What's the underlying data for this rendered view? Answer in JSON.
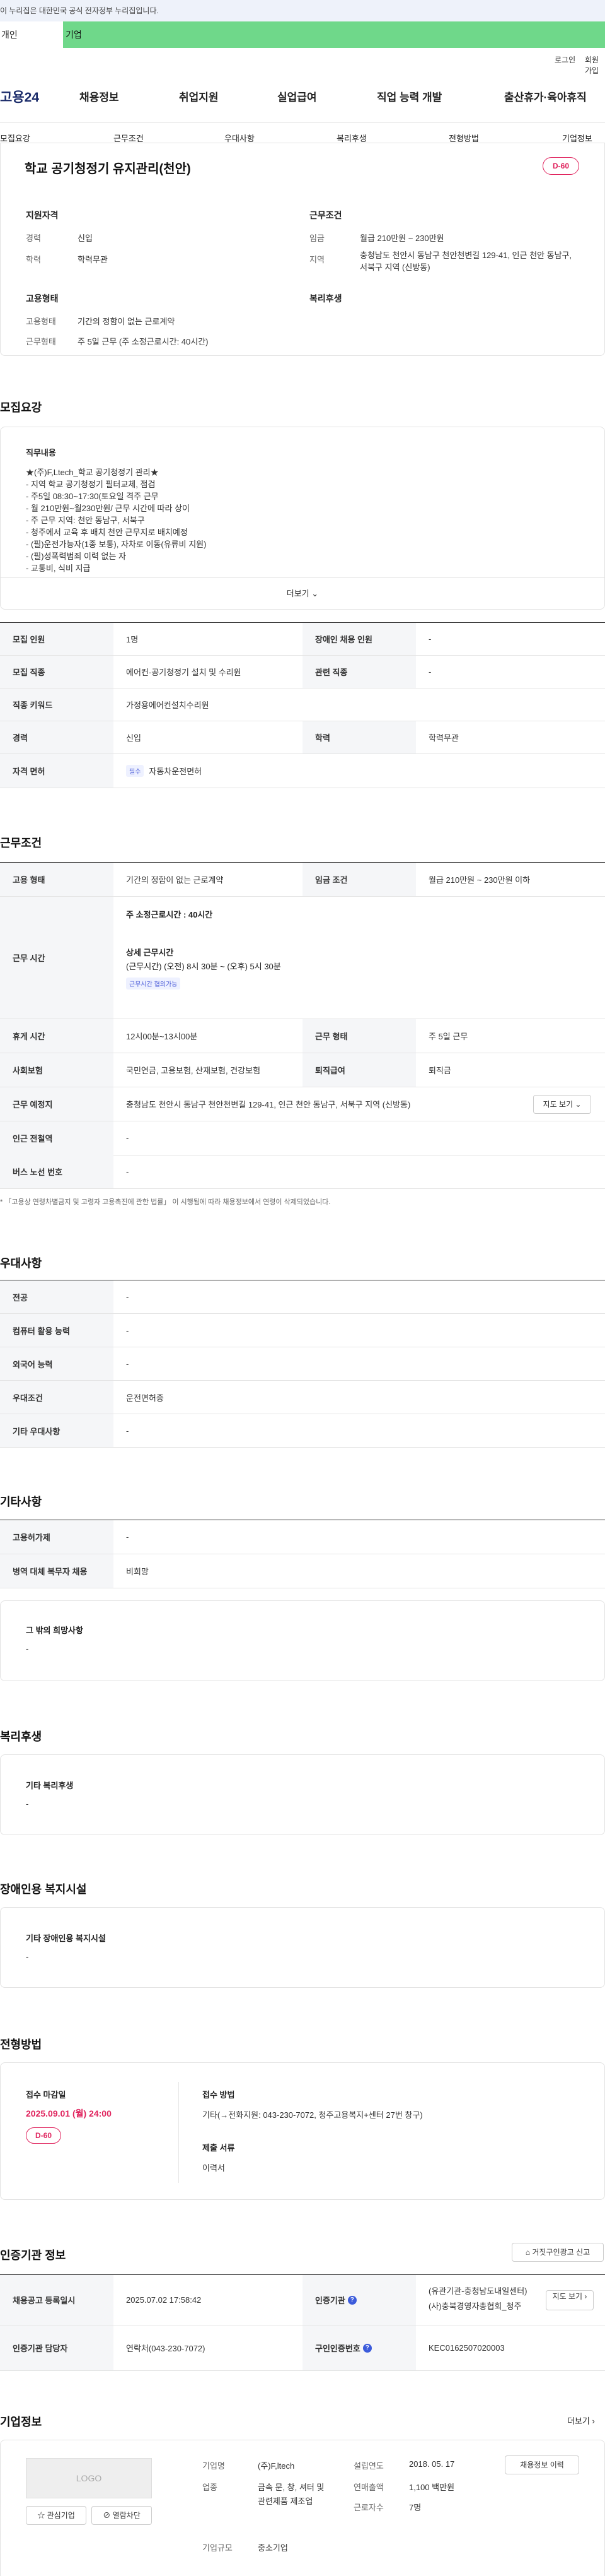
{
  "gov_banner": "이 누리집은 대한민국 공식 전자정부 누리집입니다.",
  "site_tabs": [
    "개인",
    "기업"
  ],
  "util": {
    "login": "로그인",
    "signup": "회원가입"
  },
  "logo": "고용24",
  "gnb": [
    "채용정보",
    "취업지원",
    "실업급여",
    "직업 능력 개발",
    "출산휴가·육아휴직"
  ],
  "subnav": [
    "모집요강",
    "근무조건",
    "우대사항",
    "복리후생",
    "전형방법",
    "기업정보"
  ],
  "job": {
    "title": "학교 공기청정기 유지관리(천안)",
    "dday": "D-60",
    "qual_heading": "지원자격",
    "career_label": "경력",
    "career": "신입",
    "edu_label": "학력",
    "edu": "학력무관",
    "cond_heading": "근무조건",
    "wage_label": "임금",
    "wage": "월급 210만원 ~ 230만원",
    "loc_label": "지역",
    "loc": "충청남도 천안시 동남구 천안천변길 129-41, 인근 천안 동남구, 서북구 지역 (신방동)",
    "emp_heading": "고용형태",
    "type_label": "고용형태",
    "type": "기간의 정함이 없는 근로계약",
    "form_label": "근무형태",
    "form": "주 5일 근무 (주 소정근로시간: 40시간)",
    "welfare_heading": "복리후생"
  },
  "recruit": {
    "heading": "모집요강",
    "desc_title": "직무내용",
    "desc": "★(주)F,Ltech_학교 공기청정기 관리★\n- 지역 학교 공기청정기 필터교체, 점검\n- 주5일 08:30~17:30(토요일 격주 근무\n- 월 210만원~월230만원/ 근무 시간에 따라 상이\n- 주 근무 지역: 천안 동남구, 서북구\n- 청주에서 교육 후 배치 천안 근무지로 배치예정\n- (필)운전가능자(1종 보통), 자차로 이동(유류비 지원)\n- (필)성폭력범죄 이력 없는 자\n- 교통비, 식비 지급",
    "more": "더보기",
    "rows": [
      {
        "k1": "모집 인원",
        "v1": "1명",
        "k2": "장애인 채용 인원",
        "v2": "-"
      },
      {
        "k1": "모집 직종",
        "v1": "에어컨·공기청정기 설치 및 수리원",
        "k2": "관련 직종",
        "v2": "-"
      },
      {
        "k1": "직종 키워드",
        "v1": "가정용에어컨설치수리원"
      },
      {
        "k1": "경력",
        "v1": "신입",
        "k2": "학력",
        "v2": "학력무관"
      },
      {
        "k1": "자격 면허",
        "chip": "필수",
        "v1": "자동차운전면허"
      }
    ]
  },
  "work": {
    "heading": "근무조건",
    "type_k": "고용 형태",
    "type_v": "기간의 정함이 없는 근로계약",
    "wage_k": "임금 조건",
    "wage_v": "월급 210만원 ~ 230만원 이하",
    "time_k": "근무 시간",
    "time_total": "주 소정근로시간 : 40시간",
    "time_detail_title": "상세 근무시간",
    "time_detail": "(근무시간) (오전) 8시 30분 ~ (오후) 5시 30분",
    "time_chip": "근무시간 협의가능",
    "rest_k": "휴게 시간",
    "rest_v": "12시00분~13시00분",
    "form_k": "근무 형태",
    "form_v": "주 5일 근무",
    "ins_k": "사회보험",
    "ins_v": "국민연금, 고용보험, 산재보험, 건강보험",
    "ret_k": "퇴직급여",
    "ret_v": "퇴직금",
    "place_k": "근무 예정지",
    "place_v": "충청남도 천안시 동남구 천안천변길 129-41, 인근 천안 동남구, 서북구 지역 (신방동)",
    "map_btn": "지도 보기",
    "sub_k": "인근 전철역",
    "sub_v": "-",
    "bus_k": "버스 노선 번호",
    "bus_v": "-",
    "note": "* 「고용상 연령차별금지 및 고령자 고용촉진에 관한 법률」 이 시행됨에 따라 채용정보에서 연령이 삭제되었습니다."
  },
  "pref": {
    "heading": "우대사항",
    "rows": [
      {
        "k": "전공",
        "v": "-"
      },
      {
        "k": "컴퓨터 활용 능력",
        "v": "-"
      },
      {
        "k": "외국어 능력",
        "v": "-"
      },
      {
        "k": "우대조건",
        "v": "운전면허증"
      },
      {
        "k": "기타 우대사항",
        "v": "-"
      }
    ]
  },
  "etc": {
    "heading": "기타사항",
    "rows": [
      {
        "k": "고용허가제",
        "v": "-"
      },
      {
        "k": "병역 대체 복무자 채용",
        "v": "비희망"
      }
    ],
    "wish_title": "그 밖의 희망사항",
    "wish_v": "-"
  },
  "welfare": {
    "heading": "복리후생",
    "title": "기타 복리후생",
    "v": "-"
  },
  "disab": {
    "heading": "장애인용 복지시설",
    "title": "기타 장애인용 복지시설",
    "v": "-"
  },
  "select": {
    "heading": "전형방법",
    "deadline_title": "접수 마감일",
    "deadline": "2025.09.01 (월) 24:00",
    "dday": "D-60",
    "method_title": "접수 방법",
    "method": "기타(→전화지원: 043-230-7072, 청주고용복지+센터 27번 창구)",
    "doc_title": "제출 서류",
    "doc": "이력서"
  },
  "auth": {
    "heading": "인증기관 정보",
    "report_btn": "거짓구인광고 신고",
    "reg_k": "채용공고 등록일시",
    "reg_v": "2025.07.02 17:58:42",
    "org_k": "인증기관",
    "org_v1": "(유관기관-충청남도내일센터)",
    "org_v2": "(사)충북경영자총협회_청주",
    "map_btn": "지도 보기",
    "mgr_k": "인증기관 담당자",
    "mgr_v": "연락처(043-230-7072)",
    "no_k": "구인인증번호",
    "no_v": "KEC0162507020003"
  },
  "company": {
    "heading": "기업정보",
    "more": "더보기",
    "logo": "LOGO",
    "fav": "관심기업",
    "block": "열람차단",
    "name_k": "기업명",
    "name_v": "(주)F,ltech",
    "ind_k": "업종",
    "ind_v": "금속 문, 창, 셔터 및 관련제품 제조업",
    "size_k": "기업규모",
    "size_v": "중소기업",
    "year_k": "설립연도",
    "year_v": "2018. 05. 17",
    "sales_k": "연매출액",
    "sales_v": "1,100 백만원",
    "emp_k": "근로자수",
    "emp_v": "7명",
    "btn": "채용정보 이력"
  }
}
